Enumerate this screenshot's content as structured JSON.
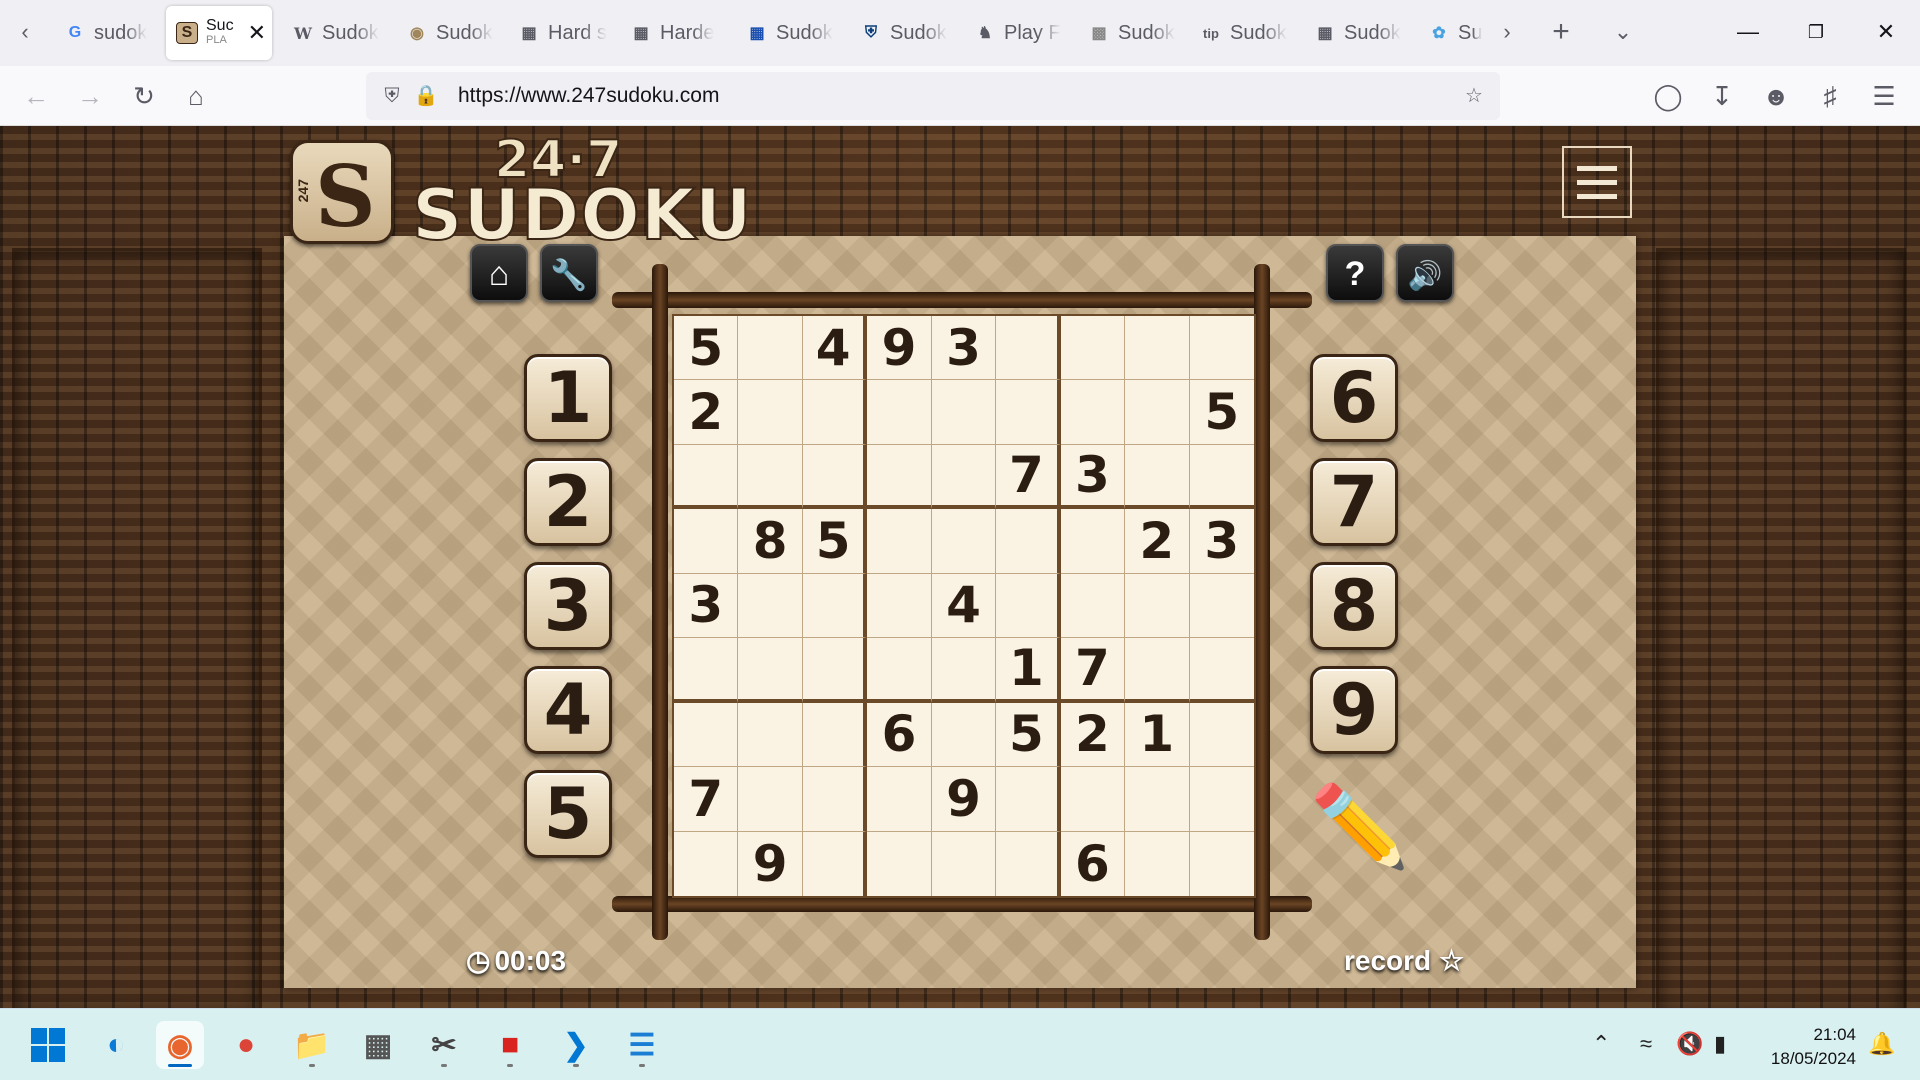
{
  "browser": {
    "tabs": [
      {
        "title": "sudok",
        "icon": "google-icon"
      },
      {
        "title": "Suc",
        "subtitle": "PLA",
        "icon": "sudoku247-icon",
        "active": true
      },
      {
        "title": "Sudok",
        "icon": "wikipedia-icon"
      },
      {
        "title": "Sudok",
        "icon": "sudoku-globe-icon"
      },
      {
        "title": "Hard s",
        "icon": "grid-icon"
      },
      {
        "title": "Harde",
        "icon": "grid-icon"
      },
      {
        "title": "Sudok",
        "icon": "blue-grid-icon"
      },
      {
        "title": "Sudok",
        "icon": "shield-icon"
      },
      {
        "title": "Play F",
        "icon": "chess-icon"
      },
      {
        "title": "Sudok",
        "icon": "dotted-grid-icon"
      },
      {
        "title": "Sudok",
        "icon": "tip-icon"
      },
      {
        "title": "Sudok",
        "icon": "grid-icon"
      },
      {
        "title": "Su",
        "icon": "bulb-icon"
      }
    ],
    "url": "https://www.247sudoku.com"
  },
  "game": {
    "logo_number": "24·7",
    "logo_word": "SUDOKU",
    "logo_letter": "S",
    "logo_vertical": "247",
    "timer": "00:03",
    "record_label": "record",
    "left_numbers": [
      "1",
      "2",
      "3",
      "4",
      "5"
    ],
    "right_numbers": [
      "6",
      "7",
      "8",
      "9"
    ],
    "grid": [
      [
        "5",
        "",
        "4",
        "9",
        "3",
        "",
        "",
        "",
        ""
      ],
      [
        "2",
        "",
        "",
        "",
        "",
        "",
        "",
        "",
        "5"
      ],
      [
        "",
        "",
        "",
        "",
        "",
        "7",
        "3",
        "",
        ""
      ],
      [
        "",
        "8",
        "5",
        "",
        "",
        "",
        "",
        "2",
        "3"
      ],
      [
        "3",
        "",
        "",
        "",
        "4",
        "",
        "",
        "",
        ""
      ],
      [
        "",
        "",
        "",
        "",
        "",
        "1",
        "7",
        "",
        ""
      ],
      [
        "",
        "",
        "",
        "6",
        "",
        "5",
        "2",
        "1",
        ""
      ],
      [
        "7",
        "",
        "",
        "",
        "9",
        "",
        "",
        "",
        ""
      ],
      [
        "",
        "9",
        "",
        "",
        "",
        "",
        "6",
        "",
        ""
      ]
    ]
  },
  "taskbar": {
    "time": "21:04",
    "date": "18/05/2024"
  }
}
